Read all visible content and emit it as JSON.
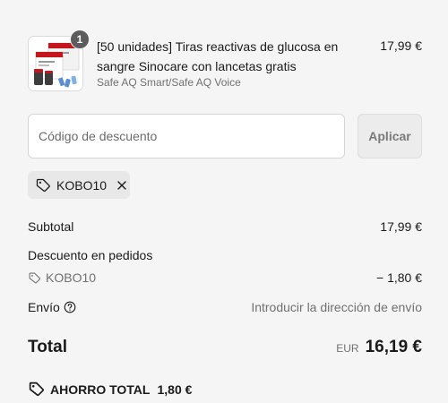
{
  "product": {
    "quantity": "1",
    "title": "[50 unidades] Tiras reactivas de glucosa en sangre Sinocare con lancetas gratis",
    "variant": "Safe AQ Smart/Safe AQ Voice",
    "price": "17,99 €",
    "image_icon": "product-thumbnail-image"
  },
  "discount": {
    "placeholder": "Código de descuento",
    "apply_label": "Aplicar",
    "applied_code": "KOBO10"
  },
  "summary": {
    "subtotal_label": "Subtotal",
    "subtotal_value": "17,99 €",
    "order_discount_label": "Descuento en pedidos",
    "discount_code": "KOBO10",
    "discount_value": "− 1,80 €",
    "shipping_label": "Envío",
    "shipping_value": "Introducir la dirección de envío",
    "total_label": "Total",
    "currency": "EUR",
    "total_value": "16,19 €",
    "savings_label": "AHORRO TOTAL",
    "savings_value": "1,80 €"
  },
  "colors": {
    "background": "#f5f5f5",
    "text": "#1a1a1a",
    "muted_text": "#707070",
    "badge": "#5c5c5c",
    "brand_red": "#c4161c"
  },
  "icons": [
    "tag-icon",
    "close-icon",
    "help-circle-icon"
  ]
}
